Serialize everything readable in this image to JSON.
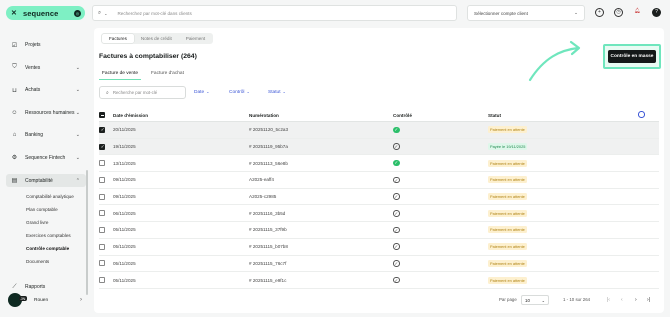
{
  "app": {
    "brand": "sequence",
    "brand_badge": "◎"
  },
  "sidebar": {
    "items": [
      {
        "label": "Projets",
        "icon": "check-square-icon",
        "chevron": ""
      },
      {
        "label": "Ventes",
        "icon": "tag-icon",
        "chevron": "⌄"
      },
      {
        "label": "Achats",
        "icon": "cart-icon",
        "chevron": "⌄"
      },
      {
        "label": "Ressources humaines",
        "icon": "people-icon",
        "chevron": "⌄"
      },
      {
        "label": "Banking",
        "icon": "bank-icon",
        "chevron": "⌄"
      },
      {
        "label": "Sequence Fintech",
        "icon": "fintech-icon",
        "chevron": "⌄"
      },
      {
        "label": "Comptabilité",
        "icon": "ledger-icon",
        "chevron": "⌃"
      }
    ],
    "sub_items": [
      {
        "label": "Comptabilité analytique"
      },
      {
        "label": "Plan comptable"
      },
      {
        "label": "Grand livre"
      },
      {
        "label": "Exercices comptables"
      },
      {
        "label": "Contrôle comptable"
      },
      {
        "label": "Documents"
      }
    ],
    "reports_label": "Rapports",
    "user_name": "Rouen",
    "user_badge": "JN",
    "user_chevron": "›"
  },
  "topbar": {
    "search_placeholder": "Recherchez par mot-clé dans clients",
    "company_placeholder": "Sélectionner compte client",
    "help": "?"
  },
  "main": {
    "segments": [
      "Factures",
      "Notes de crédit",
      "Paiement"
    ],
    "title": "Factures à comptabiliser (264)",
    "subtabs": [
      "Facture de vente",
      "Facture d'achat"
    ],
    "search_placeholder": "Recherche par mot-clé",
    "filters": [
      "Date",
      "Contrôl",
      "Statut"
    ],
    "cta": "Contrôle en masse",
    "columns": [
      "Date d'émission",
      "Numérotation",
      "Contrôlé",
      "Statut"
    ],
    "rows": [
      {
        "date": "20/11/2025",
        "num": "# 20251120_5c2a3",
        "controlled": true,
        "status": "Paiement en attente",
        "status_type": "wait",
        "selected": true
      },
      {
        "date": "19/11/2025",
        "num": "# 20251119_95b7a",
        "controlled": false,
        "status": "Payée le 19/11/2025",
        "status_type": "paid",
        "selected": true
      },
      {
        "date": "13/11/2025",
        "num": "# 20251113_56e8b",
        "controlled": true,
        "status": "Paiement en attente",
        "status_type": "wait",
        "selected": false
      },
      {
        "date": "09/11/2025",
        "num": "A2025-eaff4",
        "controlled": false,
        "status": "Paiement en attente",
        "status_type": "wait",
        "selected": false
      },
      {
        "date": "09/11/2025",
        "num": "A2025-c2985",
        "controlled": false,
        "status": "Paiement en attente",
        "status_type": "wait",
        "selected": false
      },
      {
        "date": "06/11/2025",
        "num": "# 20251116_3b5d",
        "controlled": false,
        "status": "Paiement en attente",
        "status_type": "wait",
        "selected": false
      },
      {
        "date": "05/11/2025",
        "num": "# 20251115_37f9b",
        "controlled": false,
        "status": "Paiement en attente",
        "status_type": "wait",
        "selected": false
      },
      {
        "date": "05/11/2025",
        "num": "# 20251115_b07b8",
        "controlled": false,
        "status": "Paiement en attente",
        "status_type": "wait",
        "selected": false
      },
      {
        "date": "05/11/2025",
        "num": "# 20251115_76c7f",
        "controlled": false,
        "status": "Paiement en attente",
        "status_type": "wait",
        "selected": false
      },
      {
        "date": "05/11/2025",
        "num": "# 20251115_e9f1c",
        "controlled": false,
        "status": "Paiement en attente",
        "status_type": "wait",
        "selected": false
      }
    ],
    "footer": {
      "per_page_label": "Par page",
      "per_page_value": "10",
      "range": "1 - 10 sur 264",
      "first": "|‹",
      "prev": "‹",
      "next": "›",
      "last": "›|"
    }
  },
  "colors": {
    "accent": "#7ef0c4",
    "cta_bg": "#141818",
    "link_blue": "#3a55d6"
  }
}
